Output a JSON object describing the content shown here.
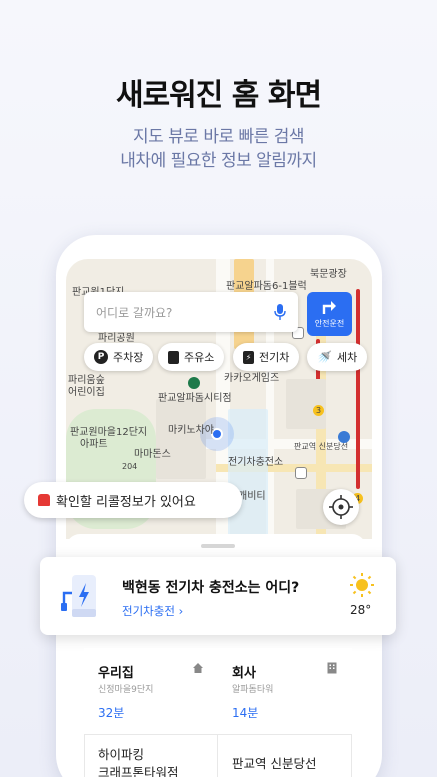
{
  "hero": {
    "title": "새로워진 홈 화면",
    "subtitle_line1": "지도 뷰로 바로 빠른 검색",
    "subtitle_line2": "내차에 필요한 정보 알림까지"
  },
  "map": {
    "labels": [
      "판교알파돔6-1블럭",
      "북문광장",
      "판교원1단지",
      "파리공원",
      "파리움숲",
      "어린이집",
      "판교알파돔시티점",
      "판교원마을12단지",
      "아파트",
      "마키노차야",
      "마마돈스",
      "전기차충전소",
      "카카오게임즈",
      "판교역 신분당선",
      "캐비티",
      "204",
      "1",
      "3",
      "4"
    ]
  },
  "search": {
    "placeholder": "어디로 갈까요?",
    "safe_drive_label": "안전운전"
  },
  "chips": [
    {
      "icon": "P",
      "label": "주차장"
    },
    {
      "icon": "fuel",
      "label": "주유소"
    },
    {
      "icon": "ev",
      "label": "전기차"
    },
    {
      "icon": "wash",
      "label": "세차"
    }
  ],
  "recall": {
    "text": "확인할 리콜정보가 있어요"
  },
  "ev_card": {
    "title": "백현동 전기차 충전소는 어디?",
    "link": "전기차충전",
    "temperature": "28°"
  },
  "favorites": [
    {
      "title": "우리집",
      "subtitle": "신정마을9단지",
      "time": "32분",
      "icon": "home-icon"
    },
    {
      "title": "회사",
      "subtitle": "알파돔타워",
      "time": "14분",
      "icon": "building-icon"
    }
  ],
  "bottom_items": {
    "left_line1": "하이파킹",
    "left_line2": "크래프톤타워점",
    "right": "판교역 신분당선"
  },
  "colors": {
    "accent": "#2b6ef2",
    "subtitle": "#6b78a6",
    "recall_red": "#e53935",
    "sun": "#f7c11e"
  }
}
